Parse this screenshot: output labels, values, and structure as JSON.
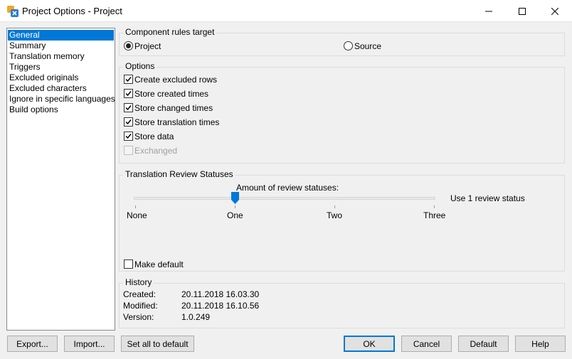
{
  "window": {
    "title": "Project Options - Project"
  },
  "nav": {
    "items": [
      {
        "label": "General",
        "selected": true
      },
      {
        "label": "Summary",
        "selected": false
      },
      {
        "label": "Translation memory",
        "selected": false
      },
      {
        "label": "Triggers",
        "selected": false
      },
      {
        "label": "Excluded originals",
        "selected": false
      },
      {
        "label": "Excluded characters",
        "selected": false
      },
      {
        "label": "Ignore in specific languages",
        "selected": false
      },
      {
        "label": "Build options",
        "selected": false
      }
    ]
  },
  "component_rules": {
    "title": "Component rules target",
    "options": [
      {
        "label": "Project",
        "selected": true
      },
      {
        "label": "Source",
        "selected": false
      }
    ]
  },
  "options": {
    "title": "Options",
    "checkboxes": [
      {
        "label": "Create excluded rows",
        "checked": true,
        "enabled": true
      },
      {
        "label": "Store created times",
        "checked": true,
        "enabled": true
      },
      {
        "label": "Store changed times",
        "checked": true,
        "enabled": true
      },
      {
        "label": "Store translation times",
        "checked": true,
        "enabled": true
      },
      {
        "label": "Store data",
        "checked": true,
        "enabled": true
      },
      {
        "label": "Exchanged",
        "checked": false,
        "enabled": false
      }
    ]
  },
  "review": {
    "title": "Translation Review Statuses",
    "slider_label": "Amount of review statuses:",
    "value_text": "Use 1 review status",
    "ticks": [
      "None",
      "One",
      "Two",
      "Three"
    ],
    "selected_index": 1,
    "make_default_label": "Make default",
    "make_default_checked": false
  },
  "history": {
    "title": "History",
    "rows": [
      {
        "label": "Created:",
        "value": "20.11.2018 16.03.30"
      },
      {
        "label": "Modified:",
        "value": "20.11.2018 16.10.56"
      },
      {
        "label": "Version:",
        "value": "1.0.249"
      }
    ]
  },
  "buttons": {
    "export": "Export...",
    "import": "Import...",
    "set_all_default": "Set all to default",
    "ok": "OK",
    "cancel": "Cancel",
    "default": "Default",
    "help": "Help"
  },
  "colors": {
    "selection": "#0078d7",
    "window_bg": "#f0f0f0"
  }
}
